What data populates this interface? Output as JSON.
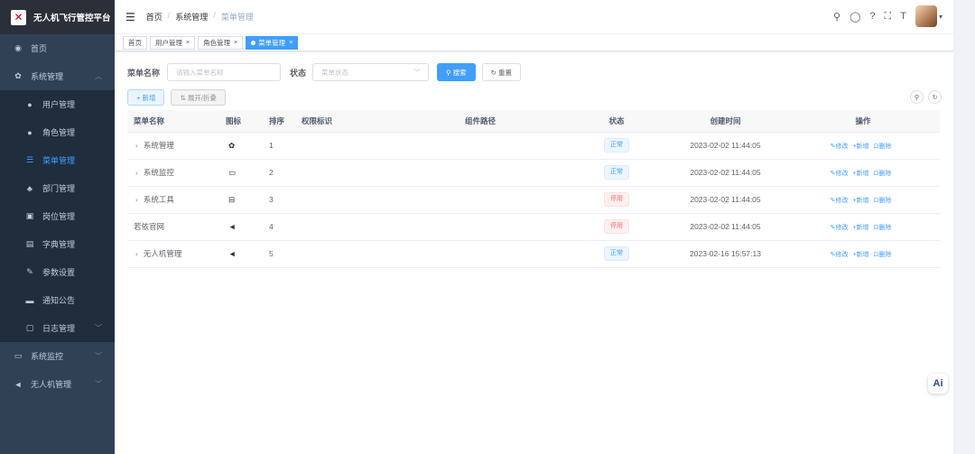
{
  "app": {
    "title": "无人机飞行管控平台",
    "logo_glyph": "✕"
  },
  "sidebar": {
    "items": [
      {
        "label": "首页",
        "icon": "dashboard-icon",
        "glyph": "◉",
        "level": "top"
      },
      {
        "label": "系统管理",
        "icon": "gear-icon",
        "glyph": "✿",
        "level": "top",
        "arrow": "︿"
      },
      {
        "label": "用户管理",
        "icon": "user-icon",
        "glyph": "●",
        "level": "sub"
      },
      {
        "label": "角色管理",
        "icon": "peoples-icon",
        "glyph": "●",
        "level": "sub"
      },
      {
        "label": "菜单管理",
        "icon": "tree-table-icon",
        "glyph": "☰",
        "level": "sub",
        "active": true
      },
      {
        "label": "部门管理",
        "icon": "tree-icon",
        "glyph": "♣",
        "level": "sub"
      },
      {
        "label": "岗位管理",
        "icon": "post-icon",
        "glyph": "▣",
        "level": "sub"
      },
      {
        "label": "字典管理",
        "icon": "dict-icon",
        "glyph": "▤",
        "level": "sub"
      },
      {
        "label": "参数设置",
        "icon": "edit-icon",
        "glyph": "✎",
        "level": "sub"
      },
      {
        "label": "通知公告",
        "icon": "message-icon",
        "glyph": "▬",
        "level": "sub"
      },
      {
        "label": "日志管理",
        "icon": "log-icon",
        "glyph": "▢",
        "level": "sub",
        "arrow": "﹀"
      },
      {
        "label": "系统监控",
        "icon": "monitor-icon",
        "glyph": "▭",
        "level": "top",
        "arrow": "﹀"
      },
      {
        "label": "无人机管理",
        "icon": "send-icon",
        "glyph": "◄",
        "level": "top",
        "arrow": "﹀"
      }
    ]
  },
  "navbar": {
    "hamburger": "☰",
    "breadcrumb": [
      "首页",
      "系统管理",
      "菜单管理"
    ],
    "sep": "/",
    "icons": {
      "search": "⚲",
      "github": "◯",
      "help": "?",
      "fullscreen": "⛶",
      "size": "T",
      "dropdown": "▾"
    }
  },
  "tags": [
    {
      "label": "首页",
      "closable": false,
      "active": false
    },
    {
      "label": "用户管理",
      "closable": true,
      "active": false
    },
    {
      "label": "角色管理",
      "closable": true,
      "active": false
    },
    {
      "label": "菜单管理",
      "closable": true,
      "active": true
    }
  ],
  "tag_close": "×",
  "search": {
    "menu_name_label": "菜单名称",
    "menu_name_placeholder": "请输入菜单名称",
    "status_label": "状态",
    "status_placeholder": "菜单状态",
    "search_button": "⚲ 搜索",
    "reset_button": "↻ 重置",
    "select_arrow": "﹀"
  },
  "toolbar": {
    "add_button": "+ 新增",
    "expand_button": "⇅ 展开/折叠",
    "search_toggle": "⚲",
    "refresh": "↻"
  },
  "table": {
    "headers": [
      "菜单名称",
      "图标",
      "排序",
      "权限标识",
      "组件路径",
      "状态",
      "创建时间",
      "操作"
    ],
    "rows": [
      {
        "name": "系统管理",
        "expand": "›",
        "icon": "✿",
        "sort": "1",
        "perm": "",
        "component": "",
        "status": "正常",
        "status_type": "ok",
        "created": "2023-02-02 11:44:05"
      },
      {
        "name": "系统监控",
        "expand": "›",
        "icon": "▭",
        "sort": "2",
        "perm": "",
        "component": "",
        "status": "正常",
        "status_type": "ok",
        "created": "2023-02-02 11:44:05"
      },
      {
        "name": "系统工具",
        "expand": "›",
        "icon": "⊟",
        "sort": "3",
        "perm": "",
        "component": "",
        "status": "停用",
        "status_type": "off",
        "created": "2023-02-02 11:44:05"
      },
      {
        "name": "若依官网",
        "expand": "",
        "icon": "◄",
        "sort": "4",
        "perm": "",
        "component": "",
        "status": "停用",
        "status_type": "off",
        "created": "2023-02-02 11:44:05"
      },
      {
        "name": "无人机管理",
        "expand": "›",
        "icon": "◄",
        "sort": "5",
        "perm": "",
        "component": "",
        "status": "正常",
        "status_type": "ok",
        "created": "2023-02-16 15:57:13"
      }
    ],
    "ops": {
      "edit": "✎修改",
      "add": "+新增",
      "delete": "⊡删除"
    }
  },
  "ai_badge": "Ai",
  "colors": {
    "primary": "#409eff",
    "sidebar": "#304156",
    "danger": "#f56c6c"
  }
}
